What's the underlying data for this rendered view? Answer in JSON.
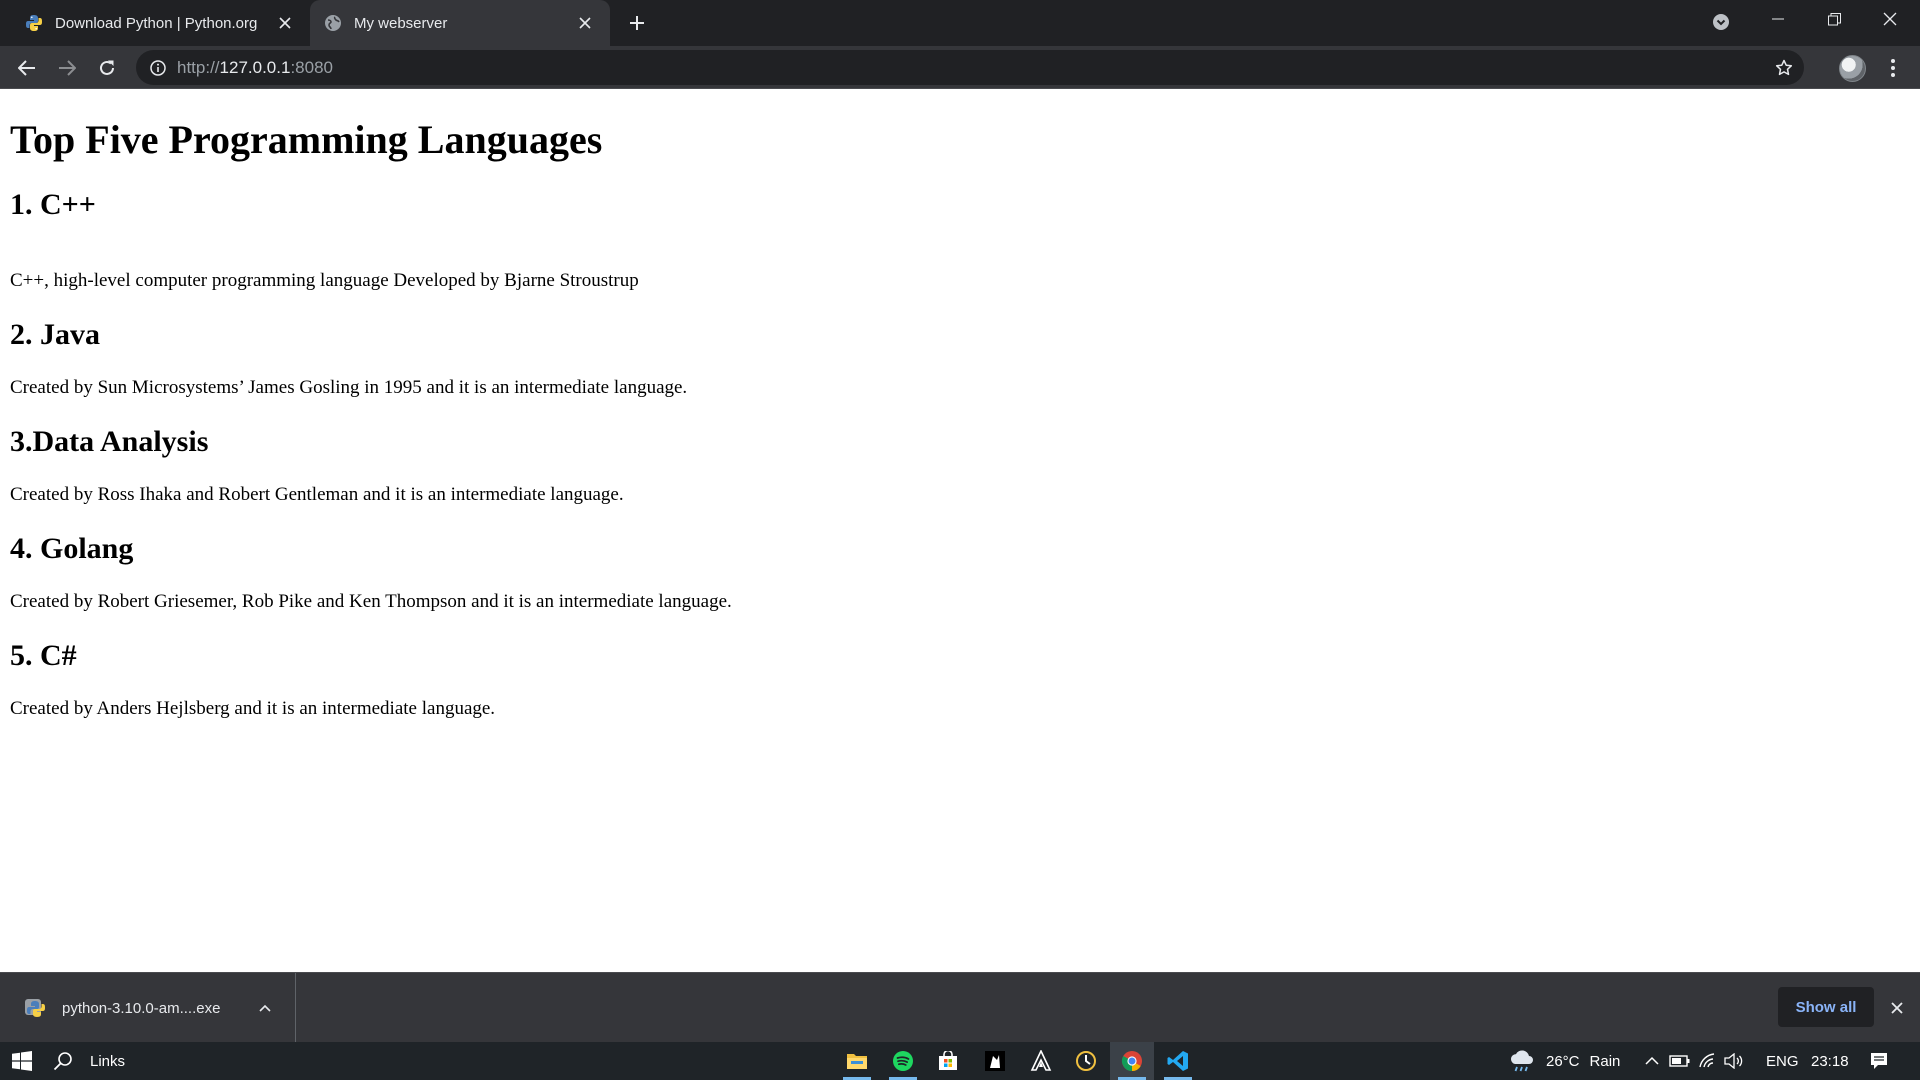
{
  "browser": {
    "tabs": [
      {
        "title": "Download Python | Python.org",
        "icon": "python-logo-icon"
      },
      {
        "title": "My webserver",
        "icon": "globe-icon"
      }
    ],
    "address": {
      "scheme": "http://",
      "host": "127.0.0.1",
      "port": ":8080"
    }
  },
  "page": {
    "title": "Top Five Programming Languages",
    "sections": [
      {
        "heading": "1. C++",
        "text": "C++, high-level computer programming language Developed by Bjarne Stroustrup"
      },
      {
        "heading": "2. Java",
        "text": "Created by Sun Microsystems’ James Gosling in 1995 and it is an intermediate language."
      },
      {
        "heading": "3.Data Analysis",
        "text": "Created by Ross Ihaka and Robert Gentleman and it is an intermediate language."
      },
      {
        "heading": "4. Golang",
        "text": "Created by Robert Griesemer, Rob Pike and Ken Thompson and it is an intermediate language."
      },
      {
        "heading": "5. C#",
        "text": "Created by Anders Hejlsberg and it is an intermediate language."
      }
    ]
  },
  "downloads": {
    "file_name": "python-3.10.0-am....exe",
    "show_all_label": "Show all"
  },
  "taskbar": {
    "search_label": "Links",
    "apps": [
      "file-explorer-icon",
      "spotify-icon",
      "store-icon",
      "game-icon",
      "assassins-creed-icon",
      "clock-app-icon",
      "chrome-icon",
      "vscode-icon"
    ],
    "weather": {
      "temp": "26°C",
      "condition": "Rain"
    },
    "language": "ENG",
    "time": "23:18"
  },
  "colors": {
    "tab_strip": "#202124",
    "toolbar": "#35363a",
    "accent_link": "#8ab4f8",
    "taskbar": "#1f2428"
  }
}
